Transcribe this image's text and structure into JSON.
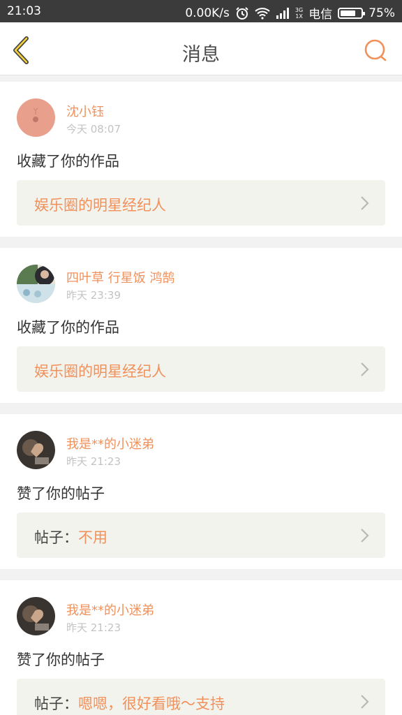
{
  "status_bar": {
    "time": "21:03",
    "speed": "0.00K/s",
    "network_top": "3G",
    "network_bottom": "1X",
    "carrier": "电信",
    "battery": "75%",
    "battery_level": 0.75,
    "icons": [
      "alarm-icon",
      "wifi-icon",
      "signal-icon",
      "battery-icon"
    ]
  },
  "header": {
    "title": "消息",
    "back_icon": "chevron-left-icon",
    "search_icon": "search-icon",
    "accent_color": "#f0915c"
  },
  "messages": [
    {
      "user": "沈小钰",
      "time": "今天 08:07",
      "action": "收藏了你的作品",
      "target_prefix": "",
      "target": "娱乐圈的明星经纪人"
    },
    {
      "user": "四叶草 行星饭 鸿鹄",
      "time": "昨天 23:39",
      "action": "收藏了你的作品",
      "target_prefix": "",
      "target": "娱乐圈的明星经纪人"
    },
    {
      "user": "我是**的小迷弟",
      "time": "昨天 21:23",
      "action": "赞了你的帖子",
      "target_prefix": "帖子：",
      "target": "不用"
    },
    {
      "user": "我是**的小迷弟",
      "time": "昨天 21:23",
      "action": "赞了你的帖子",
      "target_prefix": "帖子：",
      "target": "嗯嗯，很好看哦～支持"
    }
  ]
}
